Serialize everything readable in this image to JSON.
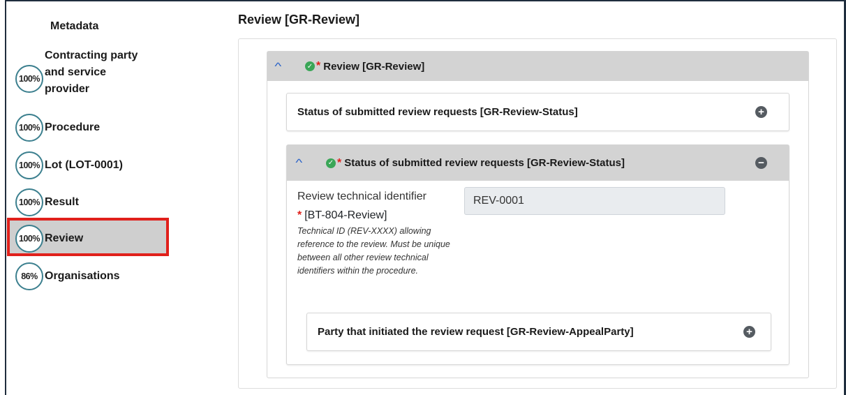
{
  "sidebar": {
    "metadata_label": "Metadata",
    "items": [
      {
        "percent": "100%",
        "label": "Contracting party and service provider",
        "active": false
      },
      {
        "percent": "100%",
        "label": "Procedure",
        "active": false
      },
      {
        "percent": "100%",
        "label": "Lot (LOT-0001)",
        "active": false
      },
      {
        "percent": "100%",
        "label": "Result",
        "active": false
      },
      {
        "percent": "100%",
        "label": "Review",
        "active": true
      },
      {
        "percent": "86%",
        "label": "Organisations",
        "active": false
      }
    ]
  },
  "main": {
    "title": "Review [GR-Review]",
    "section": {
      "header_label": "Review  [GR-Review]",
      "collapsed_card": {
        "label": "Status of submitted review requests  [GR-Review-Status]"
      },
      "expanded_card": {
        "header_label": "Status of submitted review requests  [GR-Review-Status]",
        "field": {
          "label": "Review technical identifier",
          "id": "[BT-804-Review]",
          "help": "Technical ID (REV-XXXX) allowing reference to the review. Must be unique between all other review technical identifiers within the procedure.",
          "value": "REV-0001"
        },
        "sub_card": {
          "label": "Party that initiated the review request  [GR-Review-AppealParty]"
        }
      }
    }
  },
  "colors": {
    "highlight_border": "#e0201b",
    "progress_ring": "#3b7f8e",
    "section_header_bg": "#d3d3d3",
    "check_green": "#3aa657",
    "chevron_blue": "#2a63c8"
  },
  "icons": [
    "chevron-up-icon",
    "check-circle-icon",
    "plus-circle-icon",
    "minus-circle-icon"
  ]
}
